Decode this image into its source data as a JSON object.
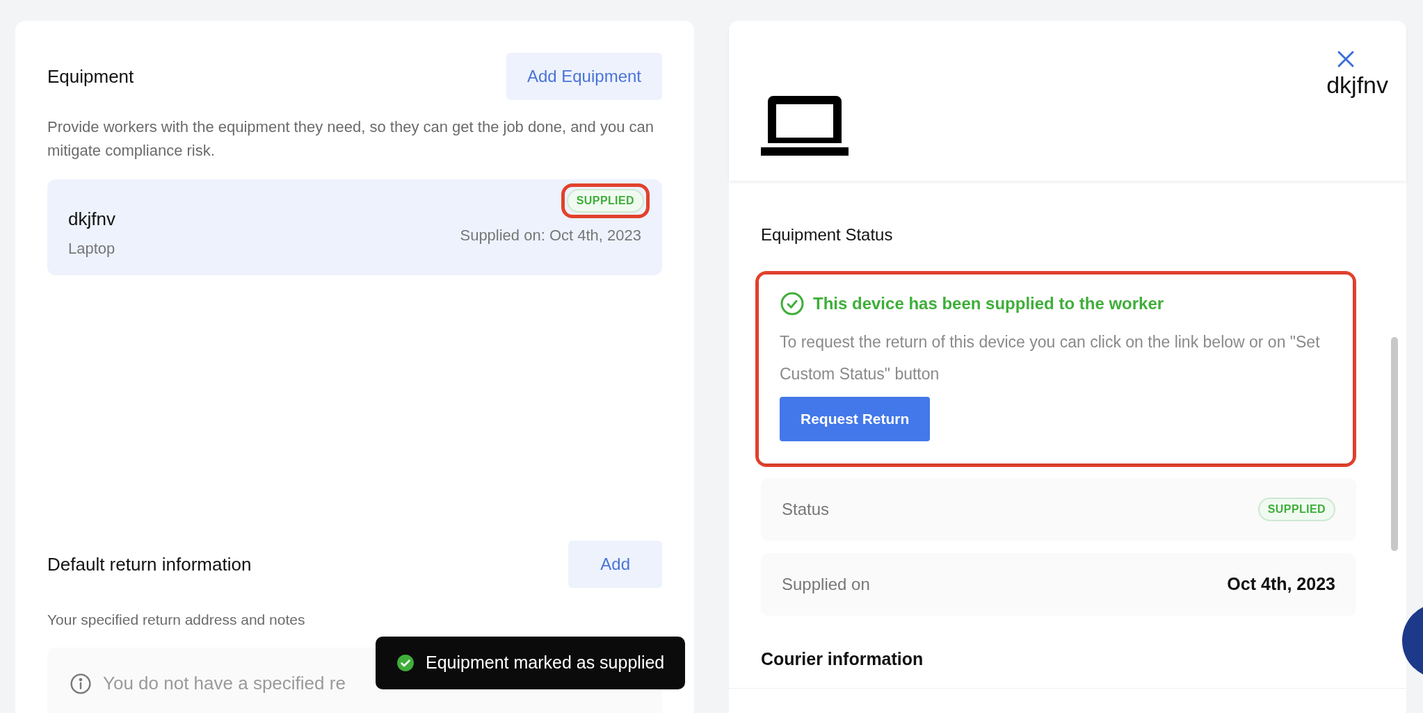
{
  "equipment": {
    "title": "Equipment",
    "add_button": "Add Equipment",
    "description": "Provide workers with the equipment they need, so they can get the job done, and you can mitigate compliance risk.",
    "items": [
      {
        "name": "dkjfnv",
        "type": "Laptop",
        "status": "SUPPLIED",
        "status_highlighted": true,
        "supplied_on": "Supplied on: Oct 4th, 2023"
      }
    ]
  },
  "return_info": {
    "title": "Default return information",
    "add_button": "Add",
    "description": "Your specified return address and notes",
    "notice": "You do not have a specified re"
  },
  "toast": {
    "message": "Equipment marked as supplied"
  },
  "detail": {
    "name": "dkjfnv",
    "section_title": "Equipment Status",
    "notice": {
      "title": "This device has been supplied to the worker",
      "body": "To request the return of this device you can click on the link below or on \"Set Custom Status\" button",
      "button": "Request Return",
      "highlighted": true
    },
    "fields": [
      {
        "kind": "badge",
        "label": "Status",
        "value": "SUPPLIED"
      },
      {
        "kind": "text",
        "label": "Supplied on",
        "value": "Oct 4th, 2023"
      }
    ],
    "courier_title": "Courier information"
  }
}
